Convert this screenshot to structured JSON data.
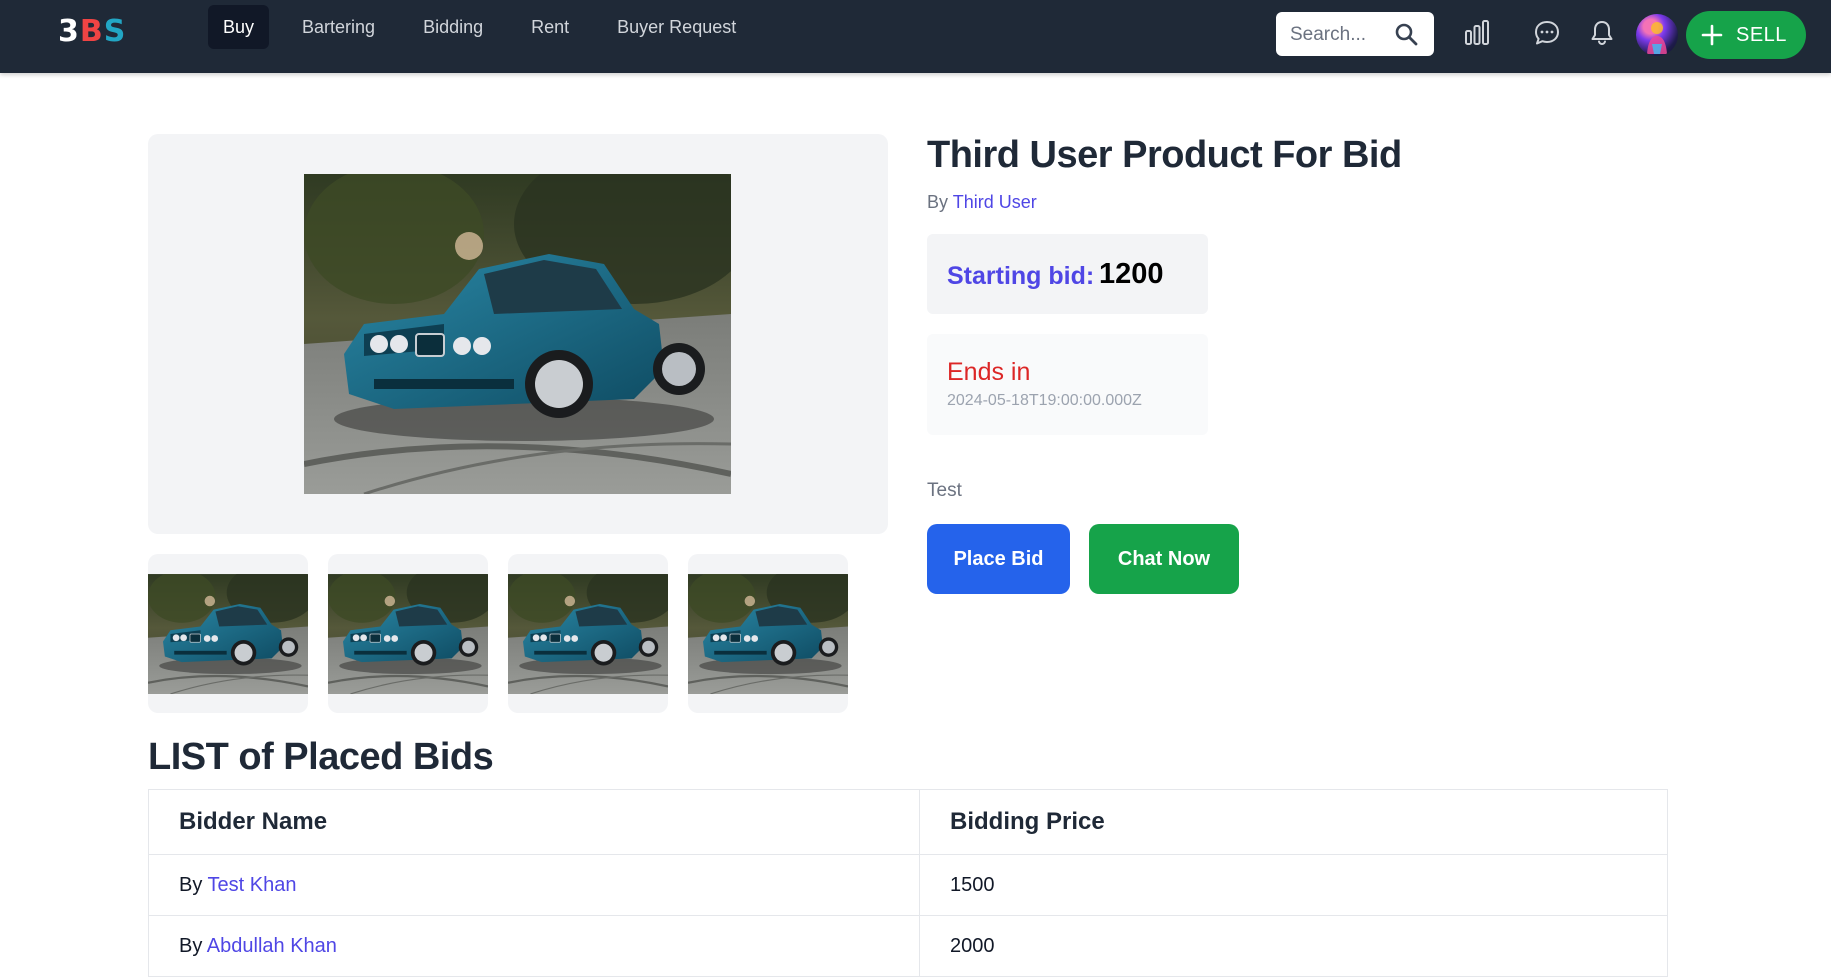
{
  "nav": {
    "logo": {
      "part1": "3",
      "part2": "B",
      "part3": "S"
    },
    "links": [
      {
        "label": "Buy",
        "active": true
      },
      {
        "label": "Bartering"
      },
      {
        "label": "Bidding"
      },
      {
        "label": "Rent"
      },
      {
        "label": "Buyer Request"
      }
    ],
    "search_placeholder": "Search...",
    "sell_label": "SELL",
    "icons": [
      "search-icon",
      "analytics-icon",
      "chat-icon",
      "bell-icon",
      "avatar",
      "plus-icon"
    ]
  },
  "product": {
    "title": "Third User Product For Bid",
    "by_prefix": "By",
    "seller": "Third User",
    "starting_bid_label": "Starting bid:",
    "starting_bid_value": "1200",
    "ends_label": "Ends in",
    "ends_value": "2024-05-18T19:00:00.000Z",
    "description": "Test",
    "place_bid_label": "Place Bid",
    "chat_now_label": "Chat Now",
    "thumbnail_count": 4
  },
  "bids": {
    "heading": "LIST of Placed Bids",
    "columns": [
      "Bidder Name",
      "Bidding Price"
    ],
    "rows": [
      {
        "by_prefix": "By",
        "name": "Test Khan",
        "price": "1500"
      },
      {
        "by_prefix": "By",
        "name": "Abdullah Khan",
        "price": "2000"
      }
    ]
  },
  "colors": {
    "navbar": "#1f2937",
    "primary_blue": "#2563eb",
    "accent_green": "#16a34a",
    "link_indigo": "#4f46e5",
    "ends_red": "#dc2626"
  }
}
